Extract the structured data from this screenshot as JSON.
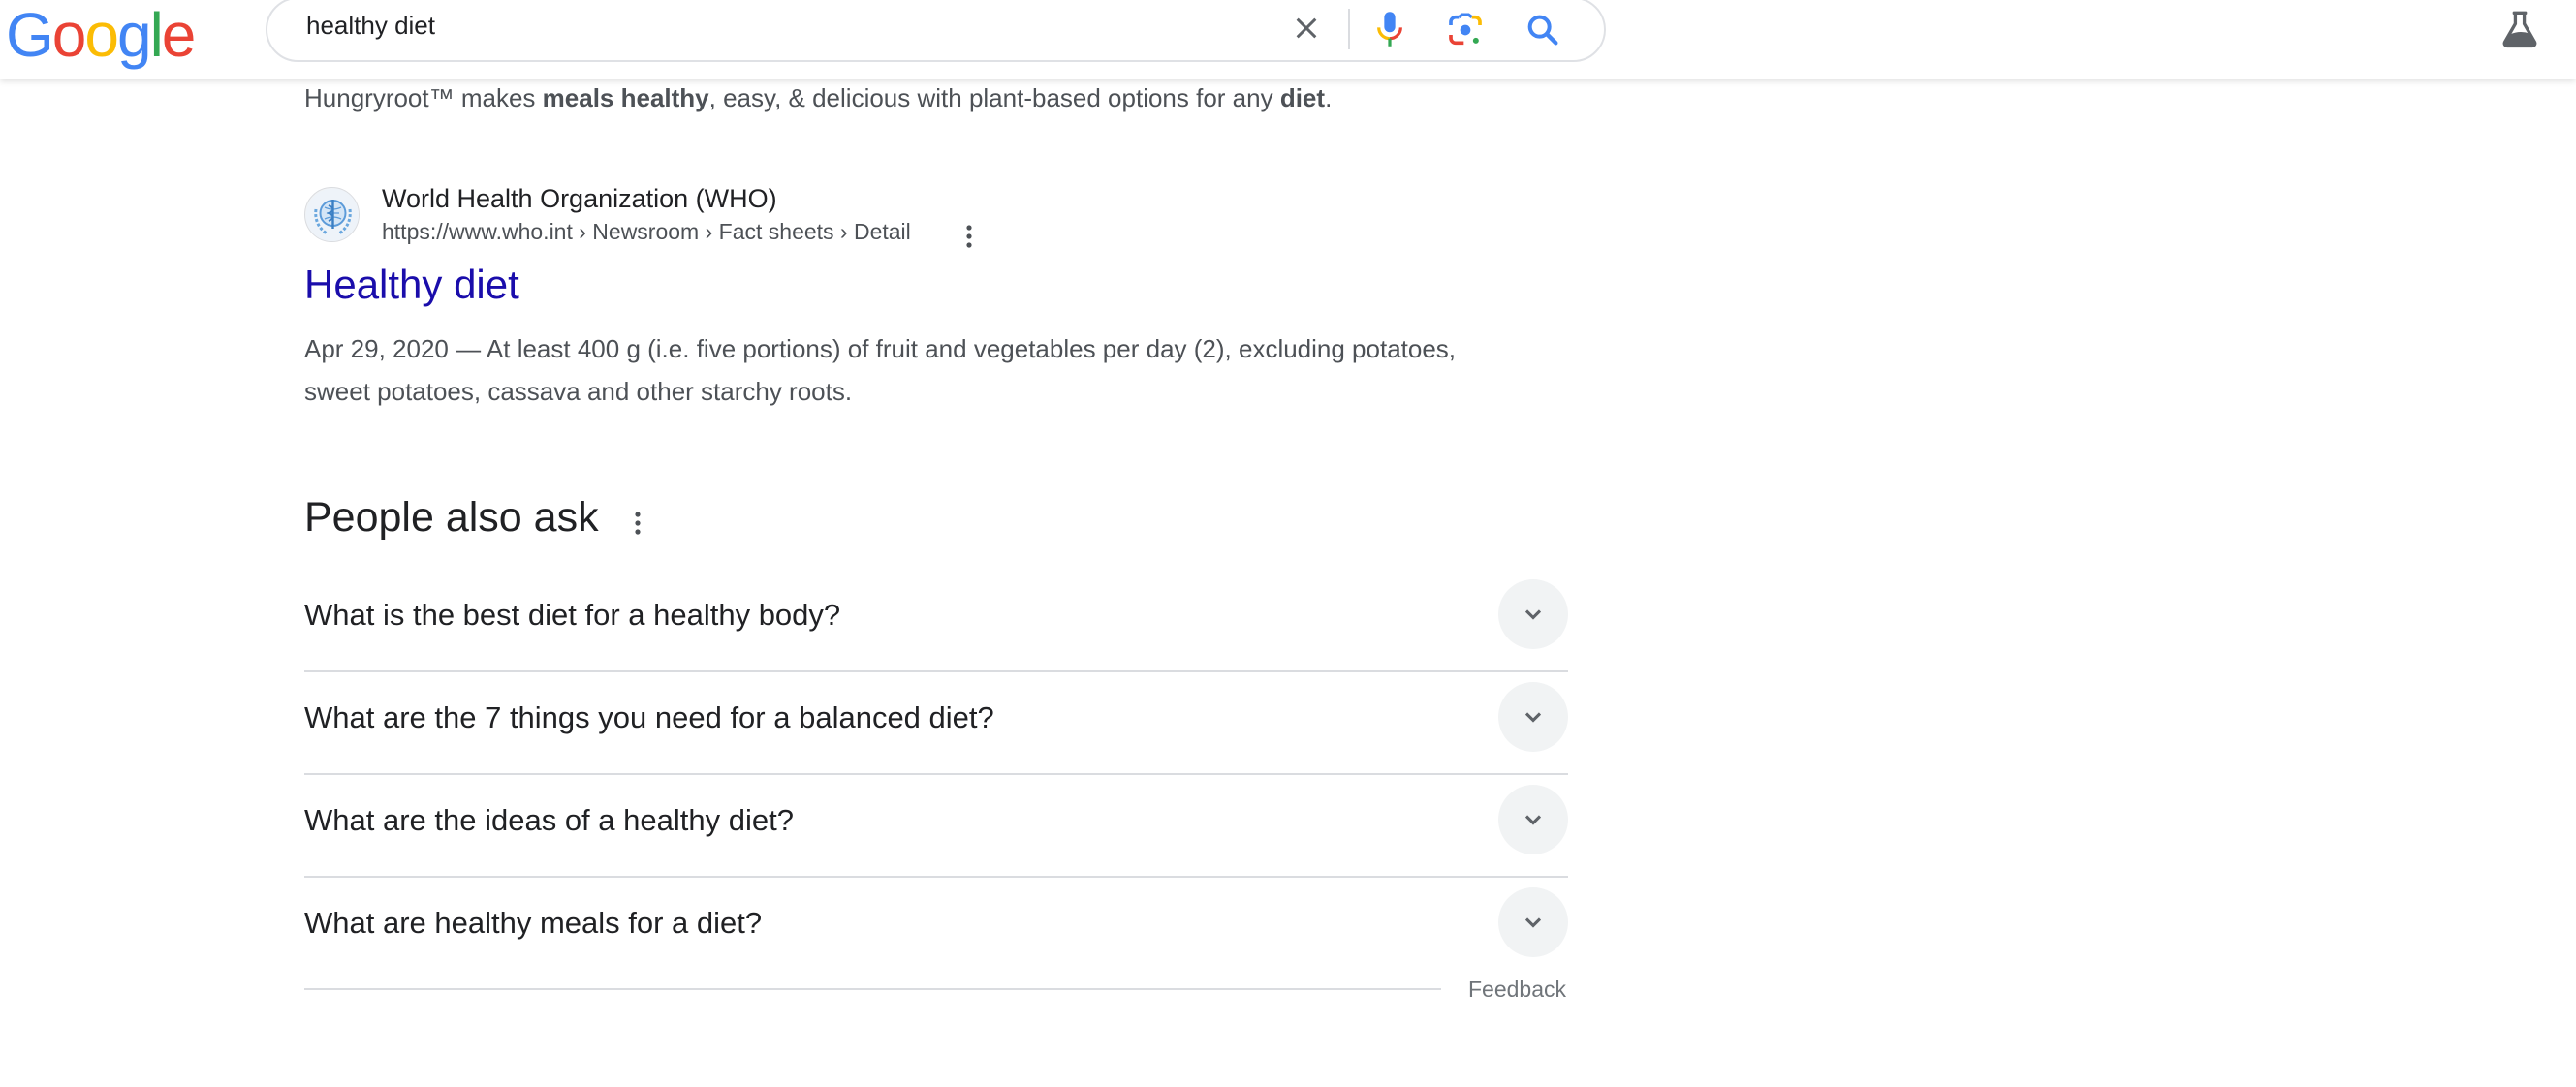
{
  "header": {
    "logo": {
      "letters": [
        "G",
        "o",
        "o",
        "g",
        "l",
        "e"
      ],
      "colors": [
        "#4285f4",
        "#ea4335",
        "#fbbc05",
        "#4285f4",
        "#34a853",
        "#ea4335"
      ]
    },
    "search": {
      "value": "healthy diet",
      "icons": {
        "clear": "close-icon",
        "voice": "microphone-icon",
        "lens": "google-lens-icon",
        "submit": "search-icon"
      }
    },
    "labs_icon": "flask-icon"
  },
  "top_snippet": {
    "parts": [
      {
        "text": "Hungryroot™ makes ",
        "bold": false
      },
      {
        "text": "meals healthy",
        "bold": true
      },
      {
        "text": ", easy, & delicious with plant-based options for any ",
        "bold": false
      },
      {
        "text": "diet",
        "bold": true
      },
      {
        "text": ".",
        "bold": false
      }
    ]
  },
  "result": {
    "site_name": "World Health Organization (WHO)",
    "url": "https://www.who.int › Newsroom › Fact sheets › Detail",
    "title": "Healthy diet",
    "date": "Apr 29, 2020",
    "description": "Apr 29, 2020 — At least 400 g (i.e. five portions) of fruit and vegetables per day (2), excluding potatoes, sweet potatoes, cassava and other starchy roots.",
    "favicon": "who-logo-icon",
    "title_color": "#1a0dab"
  },
  "people_also_ask": {
    "title": "People also ask",
    "questions": [
      "What is the best diet for a healthy body?",
      "What are the 7 things you need for a balanced diet?",
      "What are the ideas of a healthy diet?",
      "What are healthy meals for a diet?"
    ],
    "feedback_label": "Feedback"
  }
}
